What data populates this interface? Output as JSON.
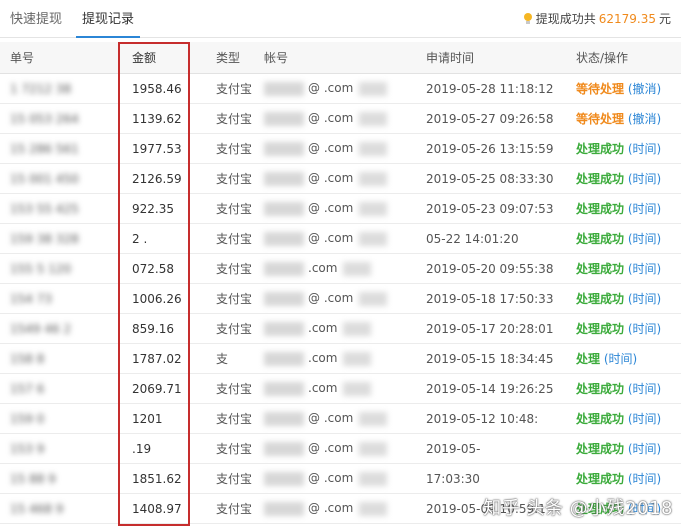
{
  "tabs": [
    {
      "label": "快速提现",
      "active": false
    },
    {
      "label": "提现记录",
      "active": true
    }
  ],
  "summary": {
    "label": "提现成功共",
    "amount": "62179.35",
    "unit": "元"
  },
  "columns": {
    "id": "单号",
    "amount": "金额",
    "type": "类型",
    "account": "帐号",
    "time": "申请时间",
    "status": "状态/操作"
  },
  "rows": [
    {
      "id": "1  7212  38",
      "amount": "1958.46",
      "type": "支付宝",
      "account": "@  .com",
      "time": "2019-05-28 11:18:12",
      "status": "等待处理",
      "status_kind": "pending",
      "op": "(撤消)"
    },
    {
      "id": "15  053  264",
      "amount": "1139.62",
      "type": "支付宝",
      "account": "@  .com",
      "time": "2019-05-27 09:26:58",
      "status": "等待处理",
      "status_kind": "pending",
      "op": "(撤消)"
    },
    {
      "id": "15  286  561",
      "amount": "1977.53",
      "type": "支付宝",
      "account": "@  .com",
      "time": "2019-05-26 13:15:59",
      "status": "处理成功",
      "status_kind": "done",
      "op": "(时间)"
    },
    {
      "id": "15  001  450",
      "amount": "2126.59",
      "type": "支付宝",
      "account": "@  .com",
      "time": "2019-05-25 08:33:30",
      "status": "处理成功",
      "status_kind": "done",
      "op": "(时间)"
    },
    {
      "id": "153  55  425",
      "amount": "922.35",
      "type": "支付宝",
      "account": "@  .com",
      "time": "2019-05-23 09:07:53",
      "status": "处理成功",
      "status_kind": "done",
      "op": "(时间)"
    },
    {
      "id": "159  38  328",
      "amount": "2  .",
      "type": "支付宝",
      "account": "@  .com",
      "time": "05-22 14:01:20",
      "status": "处理成功",
      "status_kind": "done",
      "op": "(时间)"
    },
    {
      "id": "155  5  120",
      "amount": "072.58",
      "type": "支付宝",
      "account": ".com",
      "time": "2019-05-20 09:55:38",
      "status": "处理成功",
      "status_kind": "done",
      "op": "(时间)"
    },
    {
      "id": "154  73",
      "amount": "1006.26",
      "type": "支付宝",
      "account": "@  .com",
      "time": "2019-05-18 17:50:33",
      "status": "处理成功",
      "status_kind": "done",
      "op": "(时间)"
    },
    {
      "id": "1549  46  2",
      "amount": "859.16",
      "type": "支付宝",
      "account": ".com",
      "time": "2019-05-17 20:28:01",
      "status": "处理成功",
      "status_kind": "done",
      "op": "(时间)"
    },
    {
      "id": "158  8",
      "amount": "1787.02",
      "type": "支",
      "account": ".com",
      "time": "2019-05-15 18:34:45",
      "status": "处理",
      "status_kind": "done",
      "op": "(时间)"
    },
    {
      "id": "157  6",
      "amount": "2069.71",
      "type": "支付宝",
      "account": ".com",
      "time": "2019-05-14 19:26:25",
      "status": "处理成功",
      "status_kind": "done",
      "op": "(时间)"
    },
    {
      "id": "159  0",
      "amount": "1201",
      "type": "支付宝",
      "account": "@  .com",
      "time": "2019-05-12 10:48:",
      "status": "处理成功",
      "status_kind": "done",
      "op": "(时间)"
    },
    {
      "id": "153  9",
      "amount": ".19",
      "type": "支付宝",
      "account": "@  .com",
      "time": "2019-05-",
      "status": "处理成功",
      "status_kind": "done",
      "op": "(时间)"
    },
    {
      "id": "15  88  9",
      "amount": "1851.62",
      "type": "支付宝",
      "account": "@  .com",
      "time": "17:03:30",
      "status": "处理成功",
      "status_kind": "done",
      "op": "(时间)"
    },
    {
      "id": "15  468  9",
      "amount": "1408.97",
      "type": "支付宝",
      "account": "@  .com",
      "time": "2019-05-09 10:59:1",
      "status": "处理成功",
      "status_kind": "done",
      "op": "(时间)"
    }
  ],
  "watermark": "知乎 头条 @小残2018",
  "colors": {
    "accent": "#2b86d6",
    "pending": "#f08a1c",
    "success": "#3bab3b",
    "highlight_box": "#c62d2d"
  }
}
